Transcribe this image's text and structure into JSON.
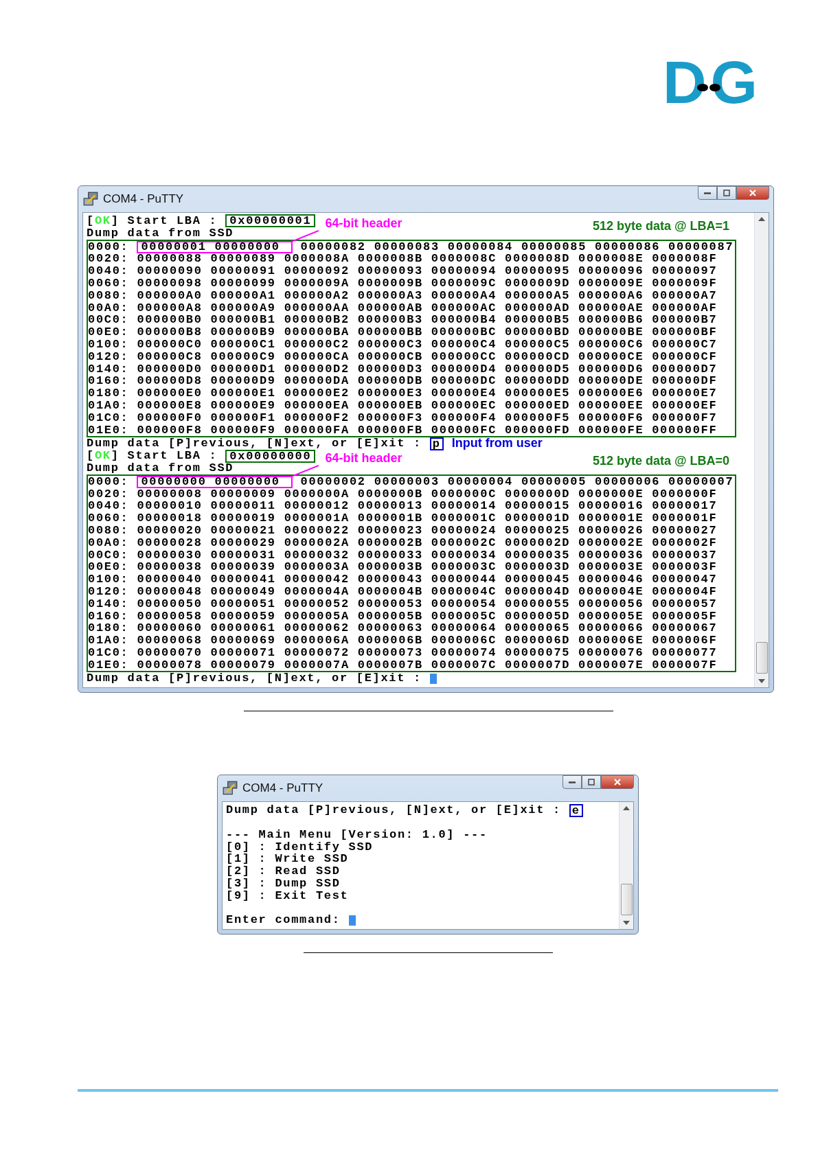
{
  "logo": {
    "left": "D",
    "right": "G"
  },
  "windows": [
    {
      "title": "COM4 - PuTTY",
      "lines": [
        {
          "kind": "status",
          "open": "[",
          "status": "OK",
          "label": "] Start LBA :",
          "value": "0x00000001",
          "note": "64-bit header"
        },
        {
          "kind": "text",
          "text": "Dump data from SSD"
        },
        {
          "kind": "hexdump",
          "note": "512 byte data @ LBA=1",
          "rows": [
            {
              "address": "0000:",
              "header": [
                "00000001",
                "00000000"
              ],
              "words": [
                "00000082",
                "00000083",
                "00000084",
                "00000085",
                "00000086",
                "00000087"
              ]
            },
            {
              "address": "0020:",
              "words": [
                "00000088",
                "00000089",
                "0000008A",
                "0000008B",
                "0000008C",
                "0000008D",
                "0000008E",
                "0000008F"
              ]
            },
            {
              "address": "0040:",
              "words": [
                "00000090",
                "00000091",
                "00000092",
                "00000093",
                "00000094",
                "00000095",
                "00000096",
                "00000097"
              ]
            },
            {
              "address": "0060:",
              "words": [
                "00000098",
                "00000099",
                "0000009A",
                "0000009B",
                "0000009C",
                "0000009D",
                "0000009E",
                "0000009F"
              ]
            },
            {
              "address": "0080:",
              "words": [
                "000000A0",
                "000000A1",
                "000000A2",
                "000000A3",
                "000000A4",
                "000000A5",
                "000000A6",
                "000000A7"
              ]
            },
            {
              "address": "00A0:",
              "words": [
                "000000A8",
                "000000A9",
                "000000AA",
                "000000AB",
                "000000AC",
                "000000AD",
                "000000AE",
                "000000AF"
              ]
            },
            {
              "address": "00C0:",
              "words": [
                "000000B0",
                "000000B1",
                "000000B2",
                "000000B3",
                "000000B4",
                "000000B5",
                "000000B6",
                "000000B7"
              ]
            },
            {
              "address": "00E0:",
              "words": [
                "000000B8",
                "000000B9",
                "000000BA",
                "000000BB",
                "000000BC",
                "000000BD",
                "000000BE",
                "000000BF"
              ]
            },
            {
              "address": "0100:",
              "words": [
                "000000C0",
                "000000C1",
                "000000C2",
                "000000C3",
                "000000C4",
                "000000C5",
                "000000C6",
                "000000C7"
              ]
            },
            {
              "address": "0120:",
              "words": [
                "000000C8",
                "000000C9",
                "000000CA",
                "000000CB",
                "000000CC",
                "000000CD",
                "000000CE",
                "000000CF"
              ]
            },
            {
              "address": "0140:",
              "words": [
                "000000D0",
                "000000D1",
                "000000D2",
                "000000D3",
                "000000D4",
                "000000D5",
                "000000D6",
                "000000D7"
              ]
            },
            {
              "address": "0160:",
              "words": [
                "000000D8",
                "000000D9",
                "000000DA",
                "000000DB",
                "000000DC",
                "000000DD",
                "000000DE",
                "000000DF"
              ]
            },
            {
              "address": "0180:",
              "words": [
                "000000E0",
                "000000E1",
                "000000E2",
                "000000E3",
                "000000E4",
                "000000E5",
                "000000E6",
                "000000E7"
              ]
            },
            {
              "address": "01A0:",
              "words": [
                "000000E8",
                "000000E9",
                "000000EA",
                "000000EB",
                "000000EC",
                "000000ED",
                "000000EE",
                "000000EF"
              ]
            },
            {
              "address": "01C0:",
              "words": [
                "000000F0",
                "000000F1",
                "000000F2",
                "000000F3",
                "000000F4",
                "000000F5",
                "000000F6",
                "000000F7"
              ]
            },
            {
              "address": "01E0:",
              "words": [
                "000000F8",
                "000000F9",
                "000000FA",
                "000000FB",
                "000000FC",
                "000000FD",
                "000000FE",
                "000000FF"
              ]
            }
          ]
        },
        {
          "kind": "prompt",
          "text": "Dump data [P]revious, [N]ext, or [E]xit :",
          "input": "p",
          "note": "Input from user"
        },
        {
          "kind": "status",
          "open": "[",
          "status": "OK",
          "label": "] Start LBA :",
          "value": "0x00000000",
          "note": "64-bit header"
        },
        {
          "kind": "text",
          "text": "Dump data from SSD"
        },
        {
          "kind": "hexdump",
          "note": "512 byte data @ LBA=0",
          "rows": [
            {
              "address": "0000:",
              "header": [
                "00000000",
                "00000000"
              ],
              "words": [
                "00000002",
                "00000003",
                "00000004",
                "00000005",
                "00000006",
                "00000007"
              ]
            },
            {
              "address": "0020:",
              "words": [
                "00000008",
                "00000009",
                "0000000A",
                "0000000B",
                "0000000C",
                "0000000D",
                "0000000E",
                "0000000F"
              ]
            },
            {
              "address": "0040:",
              "words": [
                "00000010",
                "00000011",
                "00000012",
                "00000013",
                "00000014",
                "00000015",
                "00000016",
                "00000017"
              ]
            },
            {
              "address": "0060:",
              "words": [
                "00000018",
                "00000019",
                "0000001A",
                "0000001B",
                "0000001C",
                "0000001D",
                "0000001E",
                "0000001F"
              ]
            },
            {
              "address": "0080:",
              "words": [
                "00000020",
                "00000021",
                "00000022",
                "00000023",
                "00000024",
                "00000025",
                "00000026",
                "00000027"
              ]
            },
            {
              "address": "00A0:",
              "words": [
                "00000028",
                "00000029",
                "0000002A",
                "0000002B",
                "0000002C",
                "0000002D",
                "0000002E",
                "0000002F"
              ]
            },
            {
              "address": "00C0:",
              "words": [
                "00000030",
                "00000031",
                "00000032",
                "00000033",
                "00000034",
                "00000035",
                "00000036",
                "00000037"
              ]
            },
            {
              "address": "00E0:",
              "words": [
                "00000038",
                "00000039",
                "0000003A",
                "0000003B",
                "0000003C",
                "0000003D",
                "0000003E",
                "0000003F"
              ]
            },
            {
              "address": "0100:",
              "words": [
                "00000040",
                "00000041",
                "00000042",
                "00000043",
                "00000044",
                "00000045",
                "00000046",
                "00000047"
              ]
            },
            {
              "address": "0120:",
              "words": [
                "00000048",
                "00000049",
                "0000004A",
                "0000004B",
                "0000004C",
                "0000004D",
                "0000004E",
                "0000004F"
              ]
            },
            {
              "address": "0140:",
              "words": [
                "00000050",
                "00000051",
                "00000052",
                "00000053",
                "00000054",
                "00000055",
                "00000056",
                "00000057"
              ]
            },
            {
              "address": "0160:",
              "words": [
                "00000058",
                "00000059",
                "0000005A",
                "0000005B",
                "0000005C",
                "0000005D",
                "0000005E",
                "0000005F"
              ]
            },
            {
              "address": "0180:",
              "words": [
                "00000060",
                "00000061",
                "00000062",
                "00000063",
                "00000064",
                "00000065",
                "00000066",
                "00000067"
              ]
            },
            {
              "address": "01A0:",
              "words": [
                "00000068",
                "00000069",
                "0000006A",
                "0000006B",
                "0000006C",
                "0000006D",
                "0000006E",
                "0000006F"
              ]
            },
            {
              "address": "01C0:",
              "words": [
                "00000070",
                "00000071",
                "00000072",
                "00000073",
                "00000074",
                "00000075",
                "00000076",
                "00000077"
              ]
            },
            {
              "address": "01E0:",
              "words": [
                "00000078",
                "00000079",
                "0000007A",
                "0000007B",
                "0000007C",
                "0000007D",
                "0000007E",
                "0000007F"
              ]
            }
          ]
        },
        {
          "kind": "prompt",
          "text": "Dump data [P]revious, [N]ext, or [E]xit :",
          "cursor": true
        }
      ]
    },
    {
      "title": "COM4 - PuTTY",
      "lines": [
        {
          "kind": "prompt",
          "text": "Dump data [P]revious, [N]ext, or [E]xit :",
          "input": "e"
        },
        {
          "kind": "blank"
        },
        {
          "kind": "text",
          "text": "--- Main Menu [Version: 1.0] ---"
        },
        {
          "kind": "text",
          "text": "[0] : Identify SSD"
        },
        {
          "kind": "text",
          "text": "[1] : Write SSD"
        },
        {
          "kind": "text",
          "text": "[2] : Read SSD"
        },
        {
          "kind": "text",
          "text": "[3] : Dump SSD"
        },
        {
          "kind": "text",
          "text": "[9] : Exit Test"
        },
        {
          "kind": "blank"
        },
        {
          "kind": "prompt",
          "text": "Enter command:",
          "cursor": true
        }
      ]
    }
  ]
}
